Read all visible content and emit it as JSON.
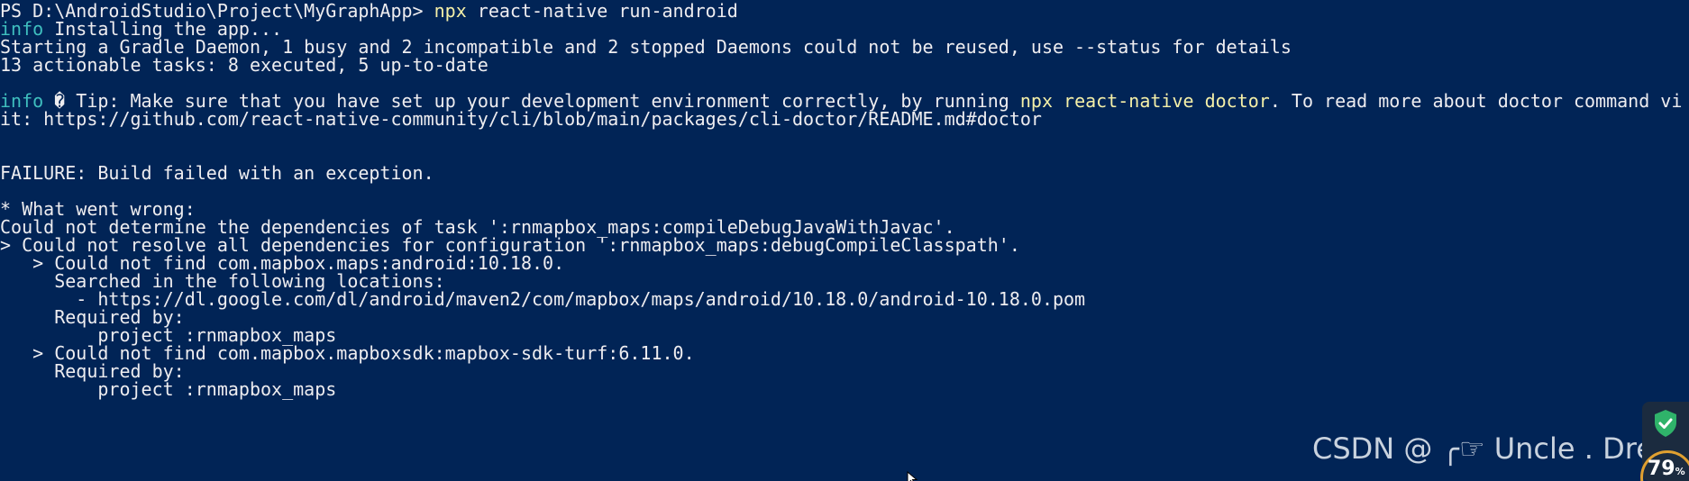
{
  "terminal": {
    "prompt": "PS D:\\AndroidStudio\\Project\\MyGraphApp> ",
    "command_exe": "npx",
    "command_args": " react-native run-android",
    "info1_tag": "info",
    "info1_text": " Installing the app...",
    "gradle_daemon": "Starting a Gradle Daemon, 1 busy and 2 incompatible and 2 stopped Daemons could not be reused, use --status for details",
    "tasks": "13 actionable tasks: 8 executed, 5 up-to-date",
    "info2_tag": "info",
    "info2_text_a": " � Tip: Make sure that you have set up your development environment correctly, by running ",
    "info2_cmd": "npx react-native doctor",
    "info2_text_b": ". To read more about doctor command vi",
    "info2_link": "it: https://github.com/react-native-community/cli/blob/main/packages/cli-doctor/README.md#doctor",
    "failure": "FAILURE: Build failed with an exception.",
    "what_went_wrong": "* What went wrong:",
    "could_not_determine": "Could not determine the dependencies of task ':rnmapbox_maps:compileDebugJavaWithJavac'.",
    "could_not_resolve": "> Could not resolve all dependencies for configuration ':rnmapbox_maps:debugCompileClasspath'.",
    "not_found_1": "   > Could not find com.mapbox.maps:android:10.18.0.",
    "searched": "     Searched in the following locations:",
    "location_1": "       - https://dl.google.com/dl/android/maven2/com/mapbox/maps/android/10.18.0/android-10.18.0.pom",
    "required_by_1": "     Required by:",
    "project_1": "         project :rnmapbox_maps",
    "not_found_2": "   > Could not find com.mapbox.mapboxsdk:mapbox-sdk-turf:6.11.0.",
    "required_by_2": "     Required by:",
    "project_2": "         project :rnmapbox_maps"
  },
  "watermark": {
    "text": "CSDN @ ╭☞ Uncle . Drew"
  },
  "tray": {
    "percent": "79"
  },
  "colors": {
    "background": "#012456",
    "foreground": "#eeedf0",
    "accent_yellow": "#f5f0a8",
    "accent_cyan": "#3fbfbf"
  }
}
